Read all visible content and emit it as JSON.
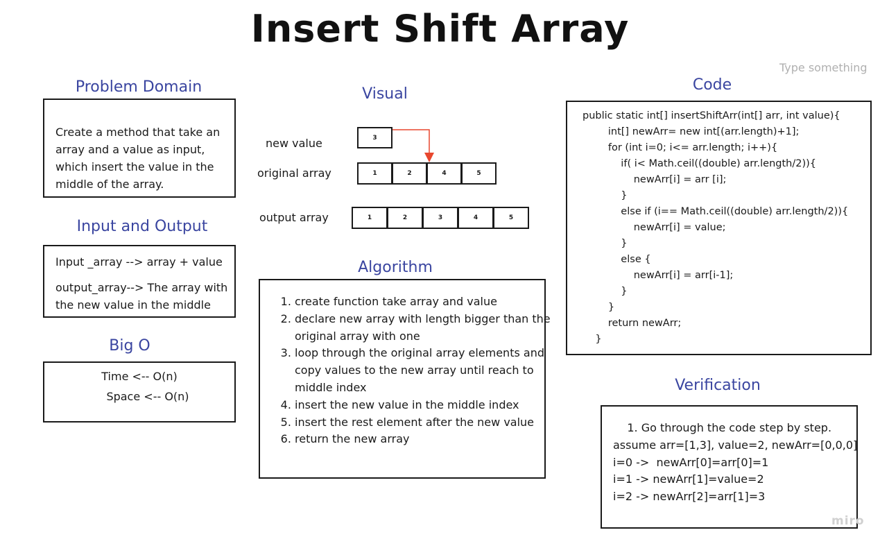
{
  "title": "Insert Shift Array",
  "hint": "Type something",
  "watermark": "miro",
  "problem_domain": {
    "heading": "Problem Domain",
    "text": "Create a method that take an array and a value as input, which insert the value in the middle of the array."
  },
  "input_output": {
    "heading": "Input and Output",
    "input": "Input _array -->  array + value",
    "output": "output_array--> The array with the new value in the middle"
  },
  "big_o": {
    "heading": "Big O",
    "time": "Time <-- O(n)",
    "space": "Space <-- O(n)"
  },
  "visual": {
    "heading": "Visual",
    "new_value_label": "new value",
    "original_label": "original array",
    "output_label": "output array",
    "new_value": "3",
    "original": [
      "1",
      "2",
      "4",
      "5"
    ],
    "output": [
      "1",
      "2",
      "3",
      "4",
      "5"
    ],
    "arrow_color": "#e8472e"
  },
  "algorithm": {
    "heading": "Algorithm",
    "steps": [
      "create function take array and value",
      "declare new array with length bigger than the original array with one",
      "loop through the original array elements and copy values to the new array until reach to middle index",
      "insert the new value in the middle index",
      "insert the rest element after the new value",
      "return the new array"
    ]
  },
  "code": {
    "heading": "Code",
    "lines": [
      "public static int[] insertShiftArr(int[] arr, int value){",
      "        int[] newArr= new int[(arr.length)+1];",
      "        for (int i=0; i<= arr.length; i++){",
      "            if( i< Math.ceil((double) arr.length/2)){",
      "                newArr[i] = arr [i];",
      "            }",
      "            else if (i== Math.ceil((double) arr.length/2)){",
      "                newArr[i] = value;",
      "            }",
      "            else {",
      "                newArr[i] = arr[i-1];",
      "            }",
      "        }",
      "        return newArr;",
      "    }"
    ]
  },
  "verification": {
    "heading": "Verification",
    "lines": [
      "    1. Go through the code step by step.",
      "assume arr=[1,3], value=2, newArr=[0,0,0]",
      "i=0 ->  newArr[0]=arr[0]=1",
      "i=1 -> newArr[1]=value=2",
      "i=2 -> newArr[2]=arr[1]=3"
    ]
  }
}
